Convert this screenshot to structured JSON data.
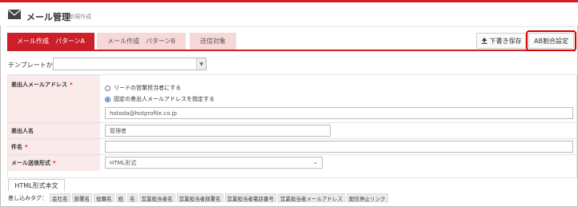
{
  "header": {
    "title": "メール管理",
    "subtitle": "新規作成"
  },
  "tabs": [
    {
      "label": "メール作成　パターンA",
      "active": true
    },
    {
      "label": "メール作成　パターンB",
      "active": false
    },
    {
      "label": "送信対象",
      "active": false
    }
  ],
  "toolbar": {
    "draft_label": "下書き保存",
    "ab_label": "AB割合設定"
  },
  "template": {
    "label": "テンプレートから入力：",
    "value": ""
  },
  "form": {
    "sender_address": {
      "label": "差出人メールアドレス",
      "required_mark": "*",
      "option_lead_owner": "リードの営業担当者にする",
      "option_fixed": "固定の差出人メールアドレスを指定する",
      "selected": "option_fixed",
      "email_value": "hotoda@hotprofile.co.jp"
    },
    "sender_name": {
      "label": "差出人名",
      "value": "管理者"
    },
    "subject": {
      "label": "件名",
      "required_mark": "*",
      "value": ""
    },
    "mail_format": {
      "label": "メール送信形式",
      "required_mark": "*",
      "value": "HTML形式"
    }
  },
  "body": {
    "tab_label": "HTML形式本文",
    "insert_label": "差し込みタグ：",
    "tags": [
      "会社名",
      "部署名",
      "役職名",
      "姓",
      "名",
      "営業担当者名",
      "営業担当者部署名",
      "営業担当者電話番号",
      "営業担当者メールアドレス",
      "配信停止リンク"
    ]
  },
  "colors": {
    "accent": "#cc1f2a",
    "tab_inactive": "#f7d7d8",
    "label_bg": "#fbeaea",
    "highlight": "#d40000"
  }
}
